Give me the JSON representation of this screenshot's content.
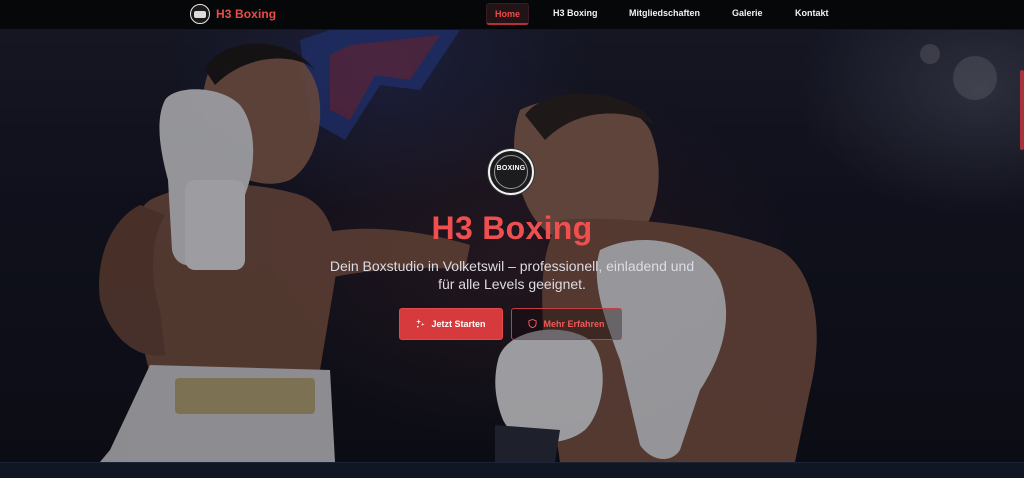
{
  "brand": {
    "name": "H3 Boxing"
  },
  "nav": {
    "items": [
      {
        "label": "Home",
        "active": true
      },
      {
        "label": "H3 Boxing",
        "active": false
      },
      {
        "label": "Mitgliedschaften",
        "active": false
      },
      {
        "label": "Galerie",
        "active": false
      },
      {
        "label": "Kontakt",
        "active": false
      }
    ]
  },
  "hero": {
    "emblem_word": "BOXING",
    "title": "H3 Boxing",
    "subtitle_line1": "Dein Boxstudio in Volketswil – professionell, einladend und",
    "subtitle_line2": "für alle Levels geeignet.",
    "primary_button": {
      "label": "Jetzt Starten",
      "icon": "sparkle-icon"
    },
    "secondary_button": {
      "label": "Mehr Erfahren",
      "icon": "shield-icon"
    }
  },
  "colors": {
    "accent": "#ef4a4a",
    "button_primary": "#d63a3c",
    "nav_background": "#060709",
    "page_background": "#0c0e14"
  }
}
